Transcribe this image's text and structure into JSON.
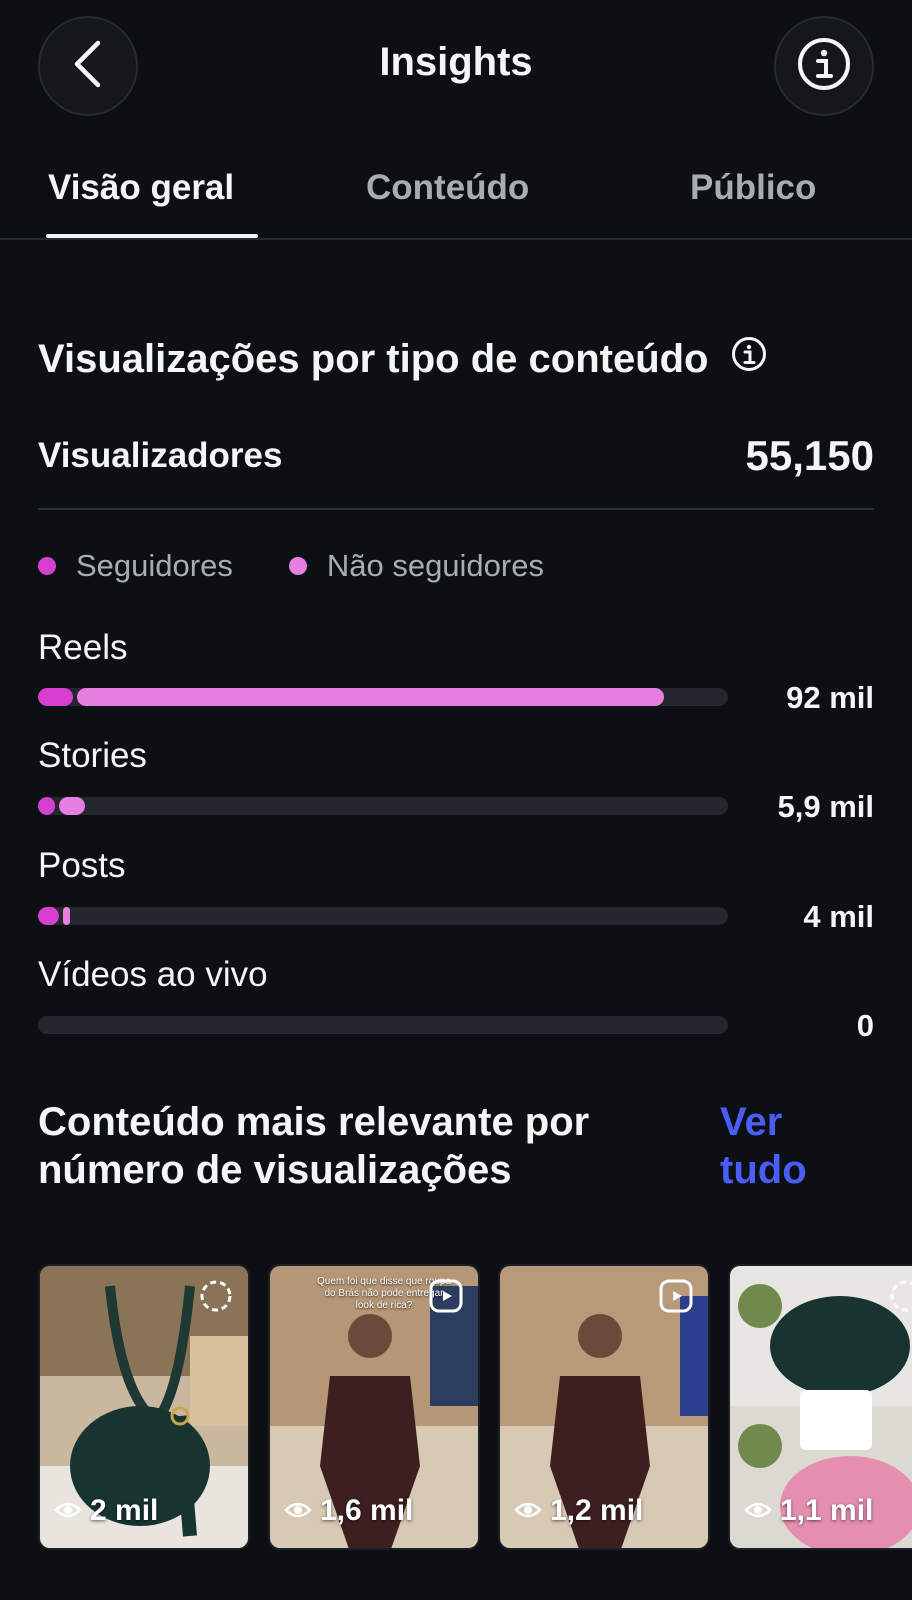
{
  "header": {
    "title": "Insights",
    "back_icon": "chevron-left-icon",
    "info_icon": "info-icon"
  },
  "tabs": [
    {
      "label": "Visão geral",
      "active": true
    },
    {
      "label": "Conteúdo",
      "active": false
    },
    {
      "label": "Público",
      "active": false
    }
  ],
  "views_section": {
    "title": "Visualizações por tipo de conteúdo",
    "viewers_label": "Visualizadores",
    "viewers_value": "55,150",
    "legend": [
      {
        "label": "Seguidores",
        "color": "#d63fd0"
      },
      {
        "label": "Não seguidores",
        "color": "#e77fe0"
      }
    ],
    "metrics": [
      {
        "label": "Reels",
        "value": "92 mil",
        "followers_fraction": 0.05,
        "non_followers_fraction": 0.85
      },
      {
        "label": "Stories",
        "value": "5,9 mil",
        "followers_fraction": 0.025,
        "non_followers_fraction": 0.037
      },
      {
        "label": "Posts",
        "value": "4 mil",
        "followers_fraction": 0.03,
        "non_followers_fraction": 0.01
      },
      {
        "label": "Vídeos ao vivo",
        "value": "0",
        "followers_fraction": 0,
        "non_followers_fraction": 0
      }
    ]
  },
  "top_content": {
    "title": "Conteúdo mais relevante por número de visualizações",
    "see_all": "Ver tudo",
    "items": [
      {
        "views": "2 mil",
        "badge_icon": "carousel-icon",
        "caption": ""
      },
      {
        "views": "1,6 mil",
        "badge_icon": "reels-icon",
        "caption": "Quem foi que disse que roupa do Brás não pode entregar look de rica?"
      },
      {
        "views": "1,2 mil",
        "badge_icon": "reels-icon",
        "caption": ""
      },
      {
        "views": "1,1 mil",
        "badge_icon": "carousel-icon",
        "caption": ""
      }
    ]
  },
  "colors": {
    "background": "#0c1014",
    "accent_link": "#4a5df9",
    "track": "#24282e"
  }
}
